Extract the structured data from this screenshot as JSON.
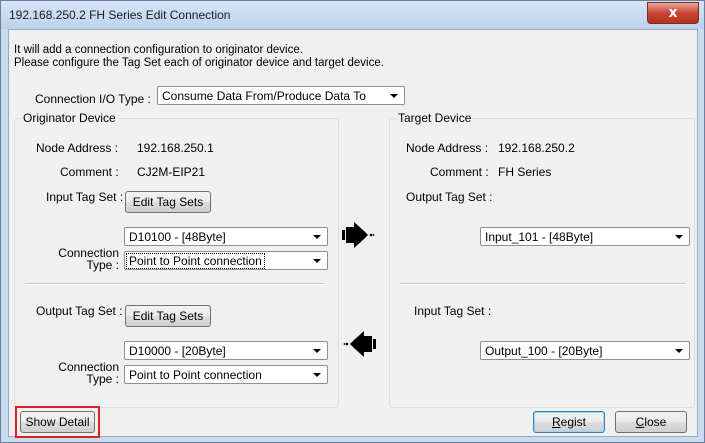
{
  "window": {
    "title": "192.168.250.2 FH Series Edit Connection",
    "close_glyph": "x"
  },
  "intro": {
    "line1": "It will add a connection configuration to originator device.",
    "line2": "Please configure the Tag Set each of originator device and target device."
  },
  "connection_io_type": {
    "label": "Connection I/O Type :",
    "value": "Consume Data From/Produce Data To"
  },
  "originator": {
    "group_label": "Originator Device",
    "node_address_label": "Node Address :",
    "node_address": "192.168.250.1",
    "comment_label": "Comment :",
    "comment": "CJ2M-EIP21",
    "input_tag_set_label": "Input Tag Set :",
    "input_edit_button": "Edit Tag Sets",
    "input_tag_value": "D10100 - [48Byte]",
    "input_connection_type_label_1": "Connection",
    "input_connection_type_label_2": "Type :",
    "input_connection_type": "Point to Point connection",
    "output_tag_set_label": "Output Tag Set :",
    "output_edit_button": "Edit Tag Sets",
    "output_tag_value": "D10000 - [20Byte]",
    "output_connection_type_label_1": "Connection",
    "output_connection_type_label_2": "Type :",
    "output_connection_type": "Point to Point connection"
  },
  "target": {
    "group_label": "Target Device",
    "node_address_label": "Node Address :",
    "node_address": "192.168.250.2",
    "comment_label": "Comment :",
    "comment": "FH Series",
    "output_tag_set_label": "Output Tag Set :",
    "output_tag_value": "Input_101 - [48Byte]",
    "input_tag_set_label": "Input Tag Set :",
    "input_tag_value": "Output_100 - [20Byte]"
  },
  "buttons": {
    "show_detail": "Show Detail",
    "regist": "Regist",
    "regist_mnemonic": "R",
    "regist_rest": "egist",
    "close": "Close",
    "close_mnemonic": "C",
    "close_rest": "lose"
  },
  "colors": {
    "highlight_box": "#e02020",
    "window_frame": "#c9dbee",
    "close_button": "#c74535"
  },
  "icons": {
    "flow_right": "data-flow-right-arrow-icon",
    "flow_left": "data-flow-left-arrow-icon"
  }
}
